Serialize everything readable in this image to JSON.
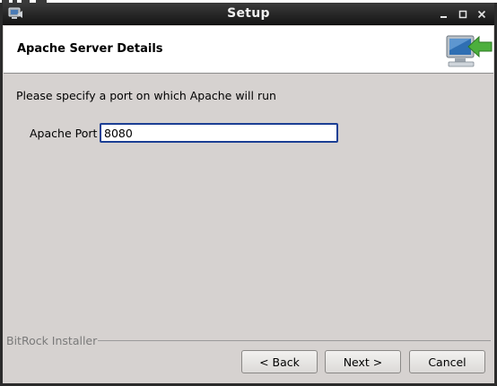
{
  "window": {
    "title": "Setup"
  },
  "header": {
    "title": "Apache Server Details"
  },
  "form": {
    "instruction": "Please specify a port on which Apache will run",
    "port_label": "Apache Port",
    "port_value": "8080"
  },
  "footer": {
    "installer_label": "BitRock Installer",
    "back_label": "< Back",
    "next_label": "Next >",
    "cancel_label": "Cancel"
  },
  "icons": {
    "title_icon": "installer-app-icon",
    "header_icon": "computer-arrow-icon",
    "minimize": "minimize-icon",
    "maximize": "maximize-icon",
    "close": "close-icon"
  },
  "colors": {
    "titlebar": "#1f1f1f",
    "window_bg": "#d6d2d0",
    "focus_border": "#1c3f94",
    "header_arrow": "#4caf3d"
  }
}
